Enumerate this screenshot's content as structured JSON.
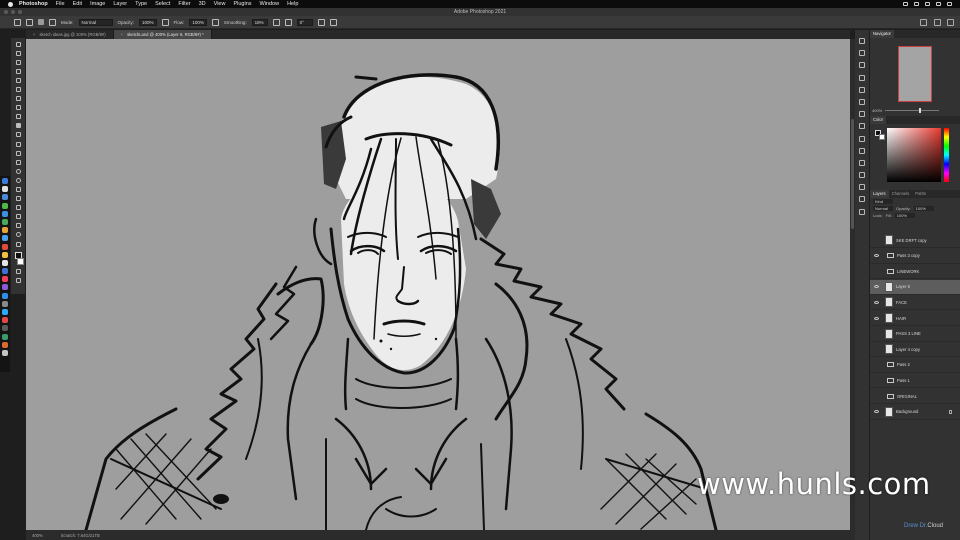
{
  "menubar": {
    "app_name": "Photoshop",
    "items": [
      "File",
      "Edit",
      "Image",
      "Layer",
      "Type",
      "Select",
      "Filter",
      "3D",
      "View",
      "Plugins",
      "Window",
      "Help"
    ]
  },
  "window_title": "Adobe Photoshop 2021",
  "options_bar": {
    "mode_label": "Mode:",
    "mode_value": "Normal",
    "opacity_label": "Opacity:",
    "opacity_value": "100%",
    "flow_label": "Flow:",
    "flow_value": "100%",
    "smoothing_label": "Smoothing:",
    "smoothing_value": "18%",
    "angle_value": "0°"
  },
  "doc_tabs": [
    {
      "label": "sketch ideas.jpg @ 100% (RGB/8#)",
      "active": false
    },
    {
      "label": "sketchLand @ 400% (Layer 6, RGB/8#) *",
      "active": true
    }
  ],
  "status": {
    "zoom": "400%",
    "doc_info": "Scratch: 7.64G/21TB"
  },
  "panels": {
    "navigator_tab": "Navigator",
    "navigator_zoom": "400%",
    "color_tab": "Color",
    "layer_tabs": [
      "Layers",
      "Channels",
      "Paths"
    ],
    "kind_label": "Kind",
    "blend_mode": "Normal",
    "opacity_label": "Opacity:",
    "opacity_value": "100%",
    "lock_label": "Lock:",
    "fill_label": "Fill:",
    "fill_value": "100%"
  },
  "layers": [
    {
      "name": "SKE DRFT copy",
      "type": "layer",
      "visible": false,
      "selected": false
    },
    {
      "name": "Pass 3 copy",
      "type": "group",
      "visible": true,
      "selected": false
    },
    {
      "name": "LINEWORK",
      "type": "group",
      "visible": false,
      "selected": false
    },
    {
      "name": "Layer 6",
      "type": "layer",
      "visible": true,
      "selected": true
    },
    {
      "name": "FACE",
      "type": "layer",
      "visible": true,
      "selected": false
    },
    {
      "name": "HAIR",
      "type": "layer",
      "visible": true,
      "selected": false
    },
    {
      "name": "PASS 3 LINE",
      "type": "layer",
      "visible": false,
      "selected": false
    },
    {
      "name": "Layer 4 copy",
      "type": "layer",
      "visible": false,
      "selected": false
    },
    {
      "name": "Pass 2",
      "type": "group",
      "visible": false,
      "selected": false
    },
    {
      "name": "Pass 1",
      "type": "group",
      "visible": false,
      "selected": false
    },
    {
      "name": "ORIGINAL",
      "type": "group",
      "visible": false,
      "selected": false
    },
    {
      "name": "Background",
      "type": "layer",
      "visible": true,
      "selected": false,
      "locked": true
    }
  ],
  "watermark": "www.hunls.com",
  "brand": {
    "part1": "Drew Dr.",
    "part2": "Cloud"
  },
  "colors": {
    "canvas": "#9e9e9e",
    "ui_dark": "#323232",
    "selected_layer": "#5d5d5d"
  }
}
